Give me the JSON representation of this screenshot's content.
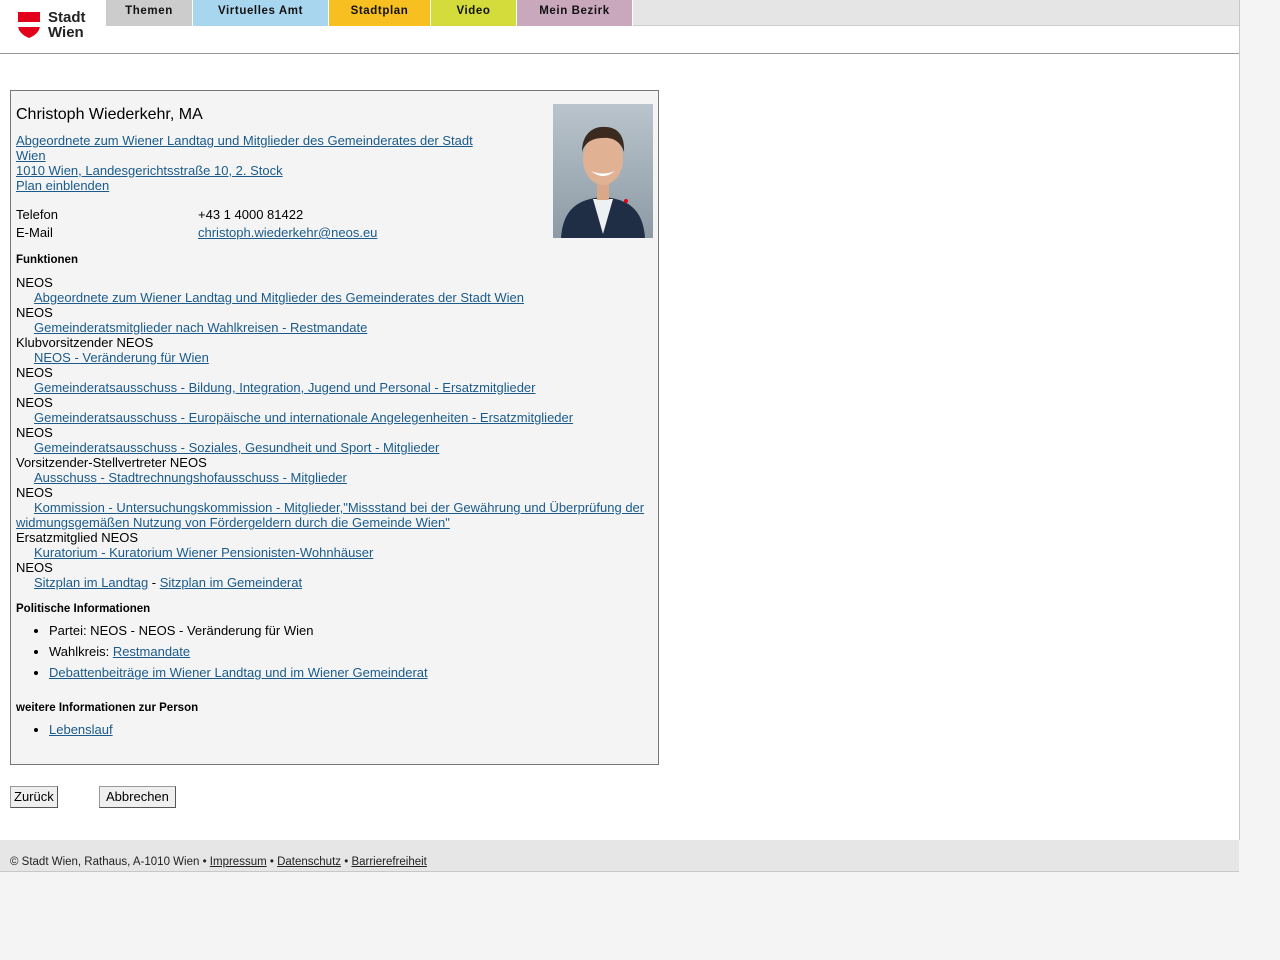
{
  "header": {
    "logo_text_line1": "Stadt",
    "logo_text_line2": "Wien",
    "tabs": [
      {
        "label": "Themen",
        "color": "#cccccc"
      },
      {
        "label": "Virtuelles Amt",
        "color": "#a9d6ef"
      },
      {
        "label": "Stadtplan",
        "color": "#f7bf1f"
      },
      {
        "label": "Video",
        "color": "#d3dc3a"
      },
      {
        "label": "Mein Bezirk",
        "color": "#c9a7bd"
      }
    ]
  },
  "person": {
    "name": "Christoph Wiederkehr, MA",
    "affiliation_line1": "Abgeordnete zum Wiener Landtag und Mitglieder des Gemeinderates der Stadt",
    "affiliation_line2": "Wien",
    "address": "1010 Wien, Landesgerichtsstraße 10, 2. Stock",
    "plan_link": "Plan einblenden",
    "phone_label": "Telefon",
    "phone": "+43 1 4000 81422",
    "email_label": "E-Mail",
    "email": "christoph.wiederkehr@neos.eu"
  },
  "funktionen_heading": "Funktionen",
  "funktionen": [
    {
      "role": "NEOS",
      "link": "Abgeordnete zum Wiener Landtag und Mitglieder des Gemeinderates der Stadt Wien"
    },
    {
      "role": "NEOS",
      "link": "Gemeinderatsmitglieder nach Wahlkreisen - Restmandate"
    },
    {
      "role": "Klubvorsitzender NEOS",
      "link": "NEOS - Veränderung für Wien"
    },
    {
      "role": "NEOS",
      "link": "Gemeinderatsausschuss - Bildung, Integration, Jugend und Personal - Ersatzmitglieder"
    },
    {
      "role": "NEOS",
      "link": "Gemeinderatsausschuss - Europäische und internationale Angelegenheiten - Ersatzmitglieder"
    },
    {
      "role": "NEOS",
      "link": "Gemeinderatsausschuss - Soziales, Gesundheit und Sport - Mitglieder"
    },
    {
      "role": "Vorsitzender-Stellvertreter NEOS",
      "link": "Ausschuss - Stadtrechnungshofausschuss - Mitglieder"
    },
    {
      "role": "NEOS",
      "link": "Kommission - Untersuchungskommission - Mitglieder,\"Missstand bei der Gewährung und Überprüfung der widmungsgemäßen Nutzung von Fördergeldern durch die Gemeinde Wien\""
    },
    {
      "role": "Ersatzmitglied NEOS",
      "link": "Kuratorium - Kuratorium Wiener Pensionisten-Wohnhäuser"
    }
  ],
  "sitzplan": {
    "role": "NEOS",
    "link1": "Sitzplan im Landtag",
    "separator": " - ",
    "link2": "Sitzplan im Gemeinderat"
  },
  "politisch_heading": "Politische Informationen",
  "politisch": {
    "partei": "Partei: NEOS - NEOS - Veränderung für Wien",
    "wahlkreis_label": "Wahlkreis: ",
    "wahlkreis_link": "Restmandate",
    "debatten_link": "Debattenbeiträge im Wiener Landtag und im Wiener Gemeinderat"
  },
  "weitere_heading": "weitere Informationen zur Person",
  "weitere": {
    "lebenslauf": "Lebenslauf"
  },
  "buttons": {
    "back": "Zurück",
    "cancel": "Abbrechen"
  },
  "footer": {
    "copyright": "© Stadt Wien, Rathaus, A-1010 Wien • ",
    "impressum": "Impressum",
    "sep1": " • ",
    "datenschutz": "Datenschutz",
    "sep2": " • ",
    "barrierefreiheit": "Barrierefreiheit"
  }
}
